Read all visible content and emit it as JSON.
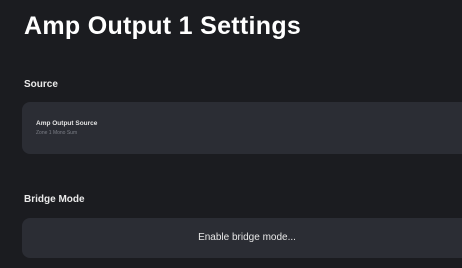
{
  "page": {
    "title": "Amp Output 1 Settings"
  },
  "source_section": {
    "heading": "Source",
    "field_label": "Amp Output Source",
    "field_value": "Zone 1 Mono Sum"
  },
  "bridge_section": {
    "heading": "Bridge Mode",
    "button_label": "Enable bridge mode..."
  },
  "colors": {
    "background": "#1b1c20",
    "card": "#2b2d34",
    "text": "#f2f2f2",
    "muted_text": "#7c7f87"
  }
}
